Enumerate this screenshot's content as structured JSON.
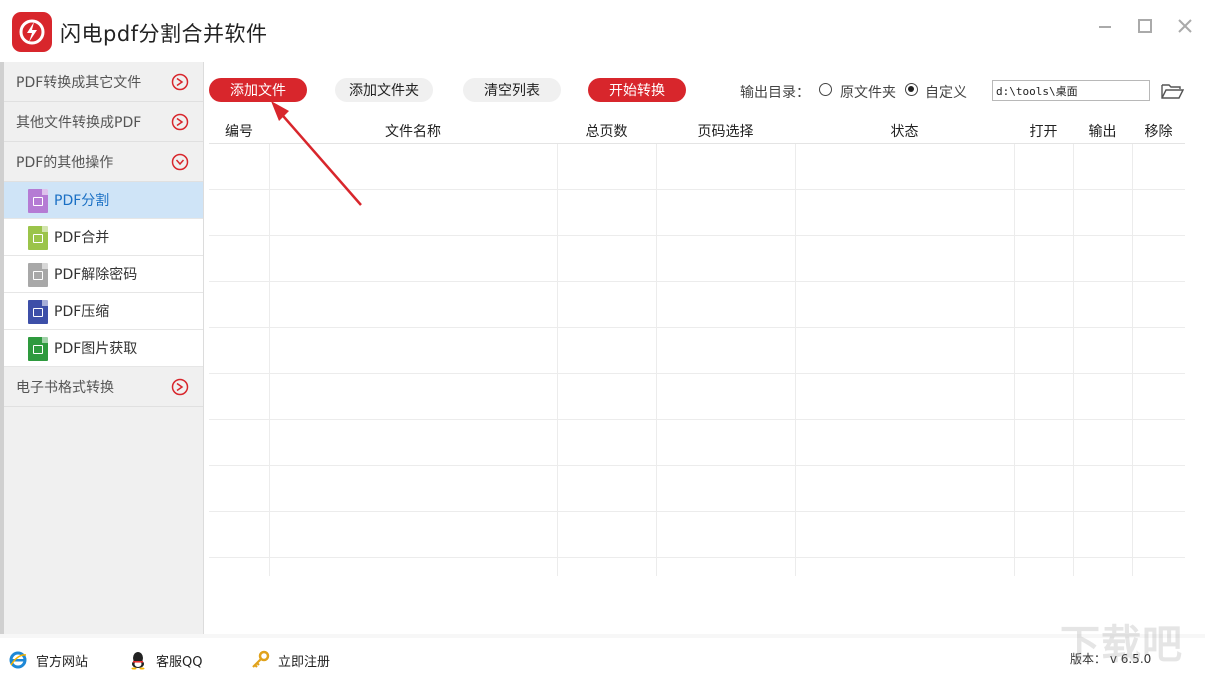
{
  "app": {
    "title": "闪电pdf分割合并软件"
  },
  "sidebar": {
    "categories": [
      {
        "label": "PDF转换成其它文件"
      },
      {
        "label": "其他文件转换成PDF"
      },
      {
        "label": "PDF的其他操作"
      },
      {
        "label": "电子书格式转换"
      }
    ],
    "sub_items": [
      {
        "label": "PDF分割",
        "color": "#b57bd4"
      },
      {
        "label": "PDF合并",
        "color": "#9bc44a"
      },
      {
        "label": "PDF解除密码",
        "color": "#a8a8a8"
      },
      {
        "label": "PDF压缩",
        "color": "#3d4fa8"
      },
      {
        "label": "PDF图片获取",
        "color": "#2e9a3e"
      }
    ]
  },
  "toolbar": {
    "add_file": "添加文件",
    "add_folder": "添加文件夹",
    "clear_list": "清空列表",
    "start_convert": "开始转换",
    "output_label": "输出目录：",
    "option_original": "原文件夹",
    "option_custom": "自定义",
    "selected_option": "自定义",
    "output_path": "d:\\tools\\桌面"
  },
  "table": {
    "headers": [
      "编号",
      "文件名称",
      "总页数",
      "页码选择",
      "状态",
      "打开",
      "输出",
      "移除"
    ]
  },
  "footer": {
    "website": "官方网站",
    "support": "客服QQ",
    "register": "立即注册",
    "version": "版本： v 6.5.0"
  },
  "colors": {
    "accent": "#d8262c",
    "active_bg": "#cfe4f7",
    "active_text": "#1a6fc4"
  },
  "watermark": "下载吧"
}
